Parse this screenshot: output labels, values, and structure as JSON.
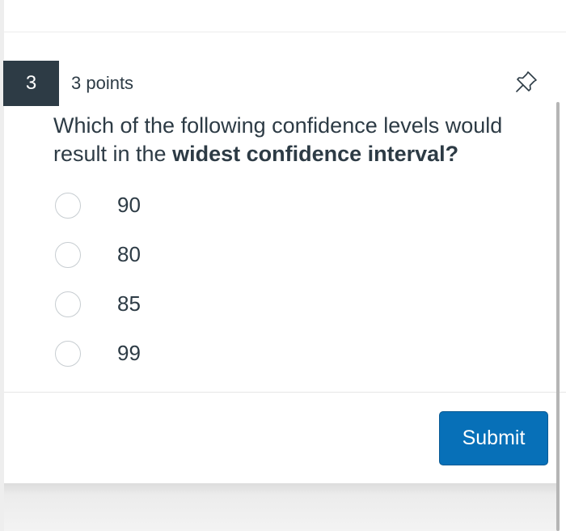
{
  "question": {
    "number": "3",
    "points": "3 points",
    "text_part1": "Which of the following confidence levels would result in the ",
    "text_bold": "widest confidence interval?"
  },
  "options": [
    {
      "label": "90"
    },
    {
      "label": "80"
    },
    {
      "label": "85"
    },
    {
      "label": "99"
    }
  ],
  "submit": {
    "label": "Submit"
  },
  "icons": {
    "pin": "pin-icon"
  },
  "colors": {
    "number_badge": "#2d3b45",
    "text": "#2d3b45",
    "submit_button": "#0770b8",
    "radio_border": "#c7cdd1"
  }
}
